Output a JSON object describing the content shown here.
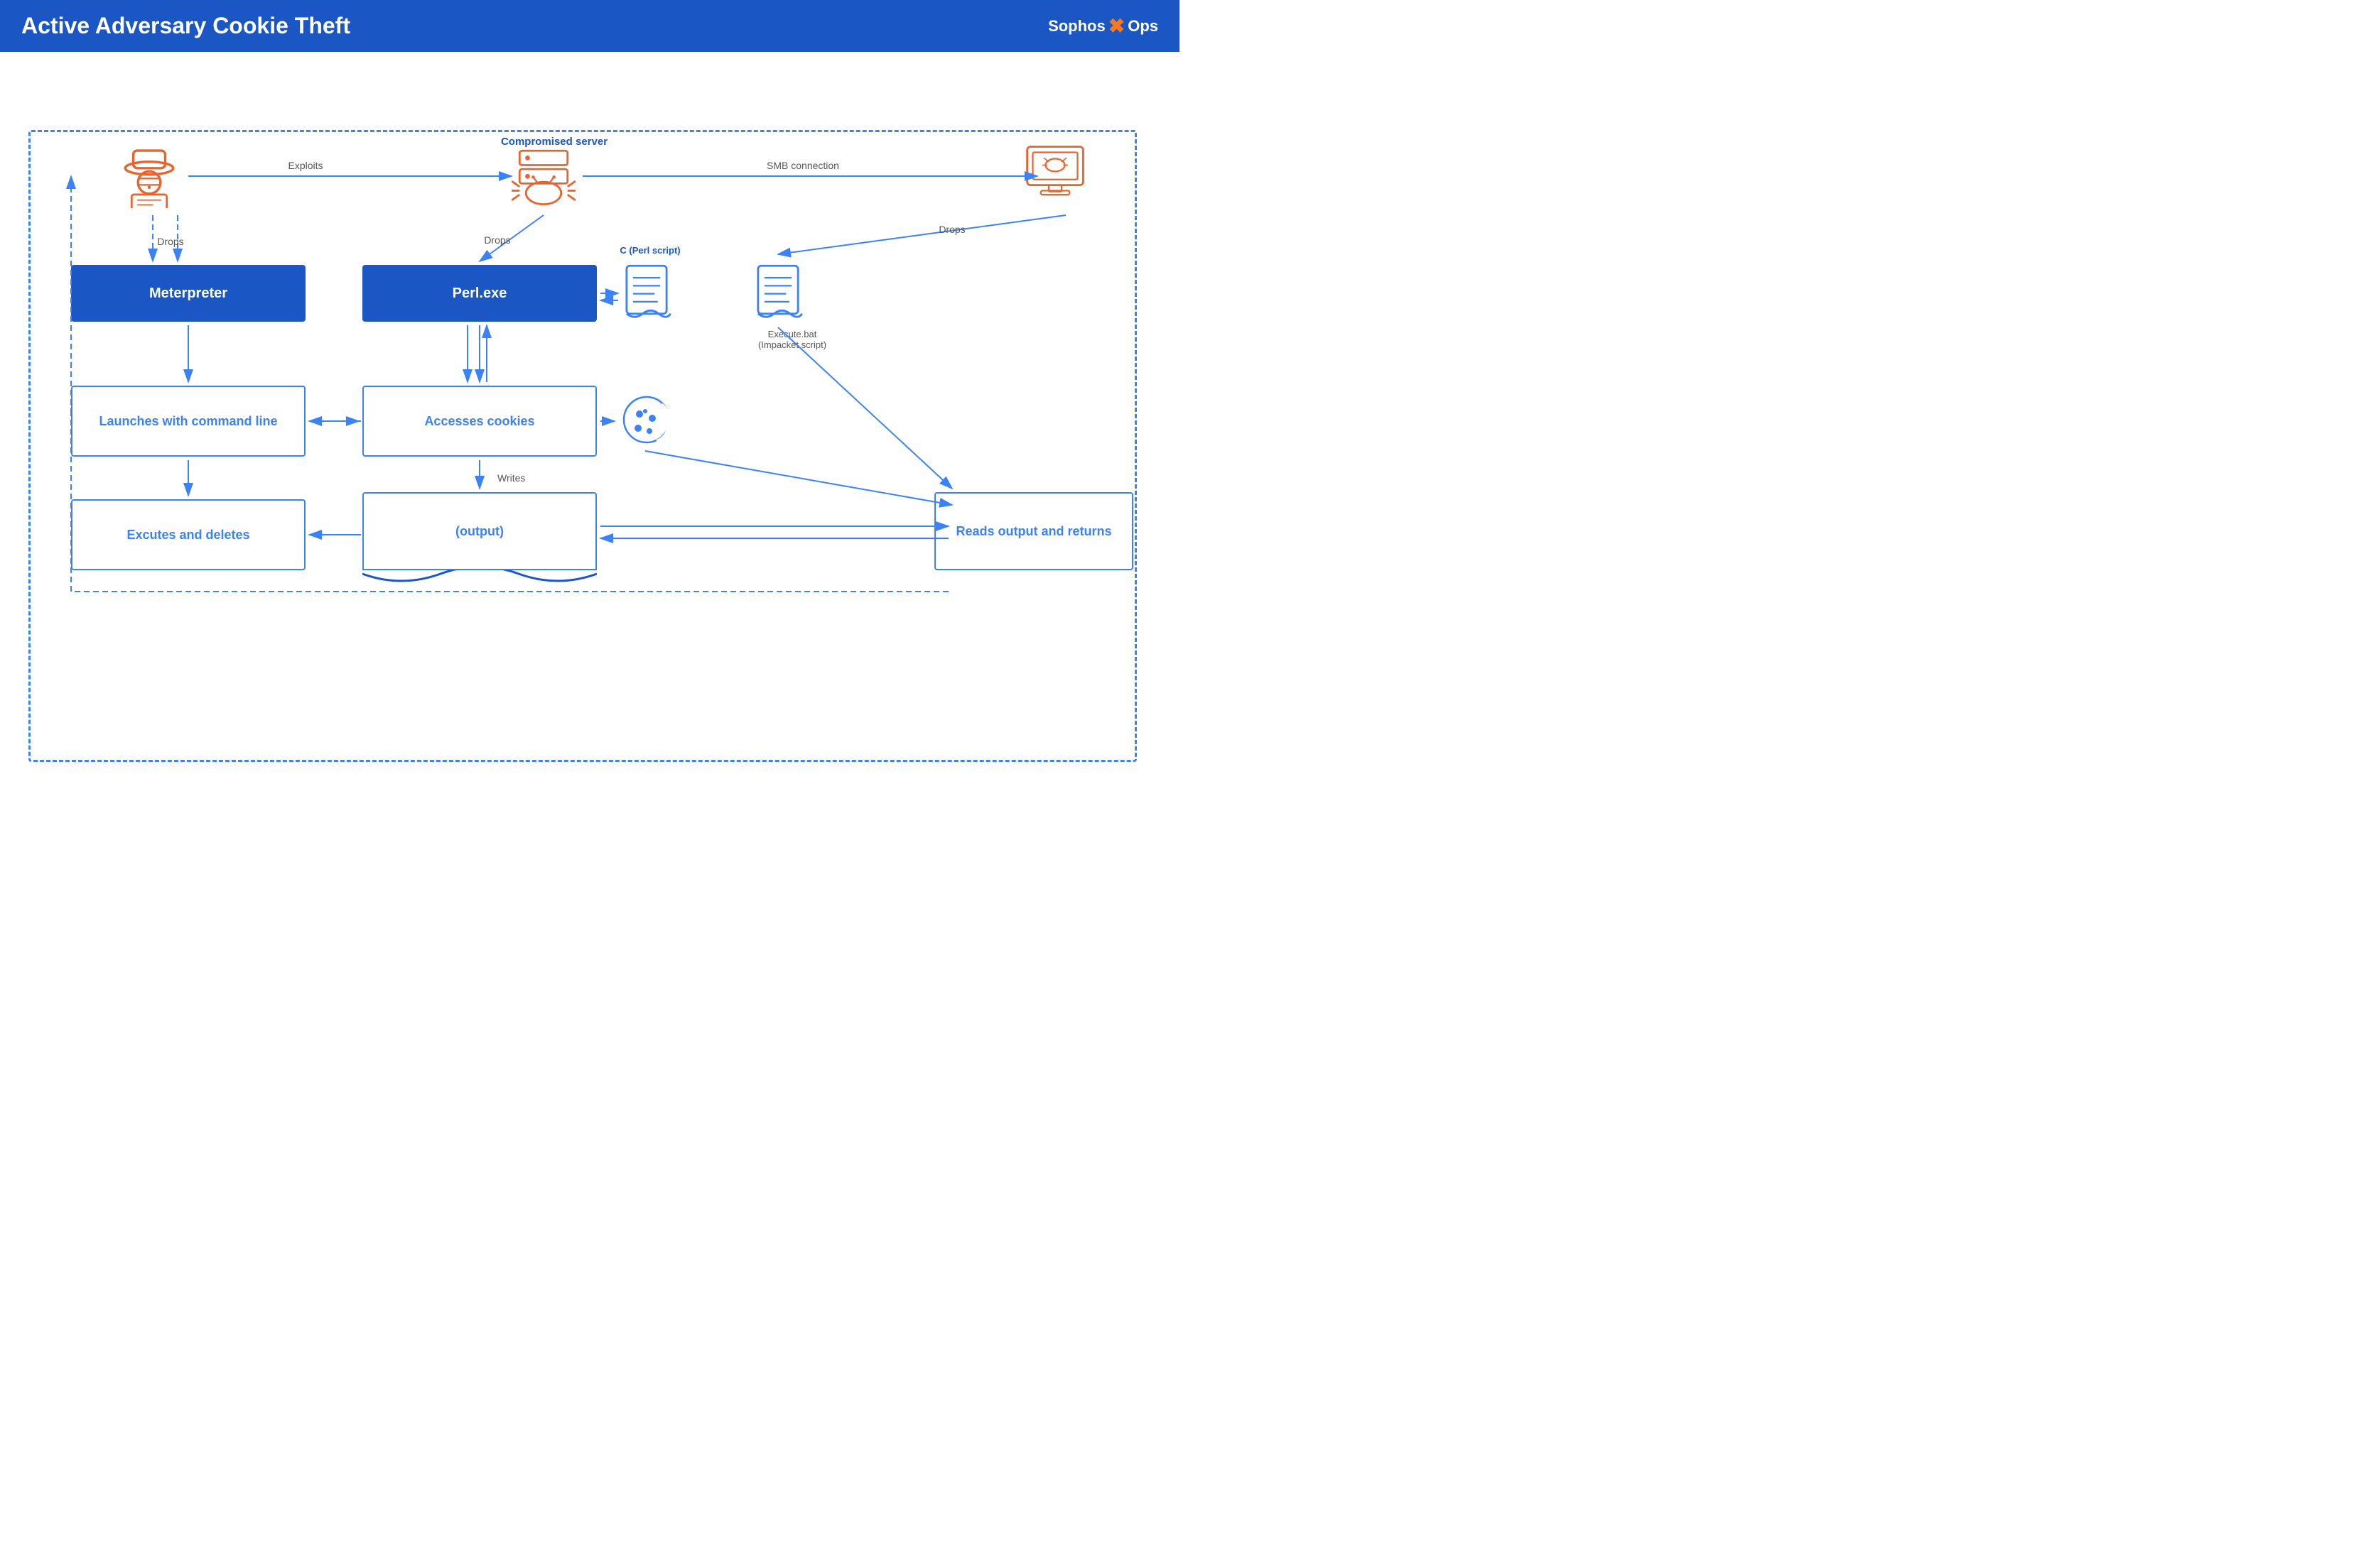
{
  "header": {
    "title": "Active Adversary Cookie Theft",
    "logo_sophos": "Sophos",
    "logo_x": "✕",
    "logo_ops": "-Ops"
  },
  "diagram": {
    "compromised_server_label": "Compromised server",
    "meterpreter_label": "Meterpreter",
    "perlexe_label": "Perl.exe",
    "launches_label": "Launches with command line",
    "accesses_label": "Accesses cookies",
    "executes_label": "Excutes and deletes",
    "output_label": "(output)",
    "reads_label": "Reads output and returns",
    "c_perl_label": "C (Perl script)",
    "execute_bat_label": "Execute.bat\n(Impacket script)",
    "arrows": {
      "exploits": "Exploits",
      "smb": "SMB connection",
      "drops1": "Drops",
      "drops2": "Drops",
      "drops3": "Drops",
      "writes": "Writes"
    }
  }
}
